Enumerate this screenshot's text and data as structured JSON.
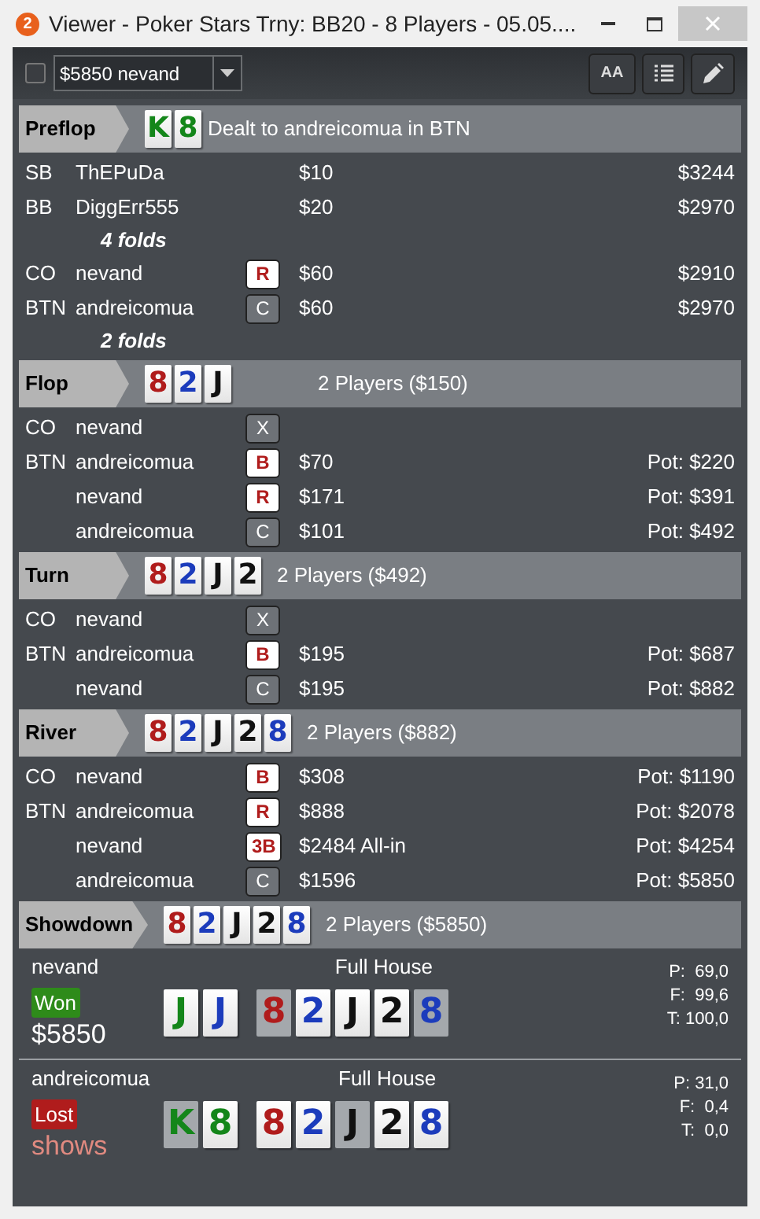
{
  "window": {
    "badge": "2",
    "title": "Viewer - Poker Stars Trny: BB20 - 8 Players - 05.05...."
  },
  "toolbar": {
    "checkbox": {
      "checked": false
    },
    "hand_select": {
      "value": "$5850 nevand"
    },
    "font_button": "AA"
  },
  "streets": [
    {
      "name": "Preflop",
      "cards": [
        {
          "rank": "K",
          "color": "#14861a"
        },
        {
          "rank": "8",
          "color": "#14861a"
        }
      ],
      "info": "Dealt to andreicomua in BTN",
      "rows": [
        {
          "kind": "action",
          "position": "SB",
          "player": "ThEPuDa",
          "amount": "$10",
          "right": "$3244"
        },
        {
          "kind": "action",
          "position": "BB",
          "player": "DiggErr555",
          "amount": "$20",
          "right": "$2970"
        },
        {
          "kind": "folds",
          "text": "4 folds"
        },
        {
          "kind": "action",
          "position": "CO",
          "player": "nevand",
          "action": {
            "label": "R",
            "aggressive": true
          },
          "amount": "$60",
          "right": "$2910"
        },
        {
          "kind": "action",
          "position": "BTN",
          "player": "andreicomua",
          "action": {
            "label": "C",
            "aggressive": false
          },
          "amount": "$60",
          "right": "$2970"
        },
        {
          "kind": "folds",
          "text": "2 folds"
        }
      ]
    },
    {
      "name": "Flop",
      "cards": [
        {
          "rank": "8",
          "color": "#b01c1c"
        },
        {
          "rank": "2",
          "color": "#1c3cbc"
        },
        {
          "rank": "J",
          "color": "#111111"
        }
      ],
      "info": "2 Players ($150)",
      "rows": [
        {
          "kind": "action",
          "position": "CO",
          "player": "nevand",
          "action": {
            "label": "X",
            "aggressive": false
          }
        },
        {
          "kind": "action",
          "position": "BTN",
          "player": "andreicomua",
          "action": {
            "label": "B",
            "aggressive": true
          },
          "amount": "$70",
          "right": "Pot: $220"
        },
        {
          "kind": "action",
          "player": "nevand",
          "action": {
            "label": "R",
            "aggressive": true
          },
          "amount": "$171",
          "right": "Pot: $391"
        },
        {
          "kind": "action",
          "player": "andreicomua",
          "action": {
            "label": "C",
            "aggressive": false
          },
          "amount": "$101",
          "right": "Pot: $492"
        }
      ]
    },
    {
      "name": "Turn",
      "cards": [
        {
          "rank": "8",
          "color": "#b01c1c"
        },
        {
          "rank": "2",
          "color": "#1c3cbc"
        },
        {
          "rank": "J",
          "color": "#111111"
        },
        {
          "rank": "2",
          "color": "#111111"
        }
      ],
      "info": "2 Players ($492)",
      "rows": [
        {
          "kind": "action",
          "position": "CO",
          "player": "nevand",
          "action": {
            "label": "X",
            "aggressive": false
          }
        },
        {
          "kind": "action",
          "position": "BTN",
          "player": "andreicomua",
          "action": {
            "label": "B",
            "aggressive": true
          },
          "amount": "$195",
          "right": "Pot: $687"
        },
        {
          "kind": "action",
          "player": "nevand",
          "action": {
            "label": "C",
            "aggressive": false
          },
          "amount": "$195",
          "right": "Pot: $882"
        }
      ]
    },
    {
      "name": "River",
      "cards": [
        {
          "rank": "8",
          "color": "#b01c1c"
        },
        {
          "rank": "2",
          "color": "#1c3cbc"
        },
        {
          "rank": "J",
          "color": "#111111"
        },
        {
          "rank": "2",
          "color": "#111111"
        },
        {
          "rank": "8",
          "color": "#1c3cbc"
        }
      ],
      "info": "2 Players ($882)",
      "rows": [
        {
          "kind": "action",
          "position": "CO",
          "player": "nevand",
          "action": {
            "label": "B",
            "aggressive": true
          },
          "amount": "$308",
          "right": "Pot: $1190"
        },
        {
          "kind": "action",
          "position": "BTN",
          "player": "andreicomua",
          "action": {
            "label": "R",
            "aggressive": true
          },
          "amount": "$888",
          "right": "Pot: $2078"
        },
        {
          "kind": "action",
          "player": "nevand",
          "action": {
            "label": "3B",
            "aggressive": true
          },
          "amount": "$2484 All-in",
          "right": "Pot: $4254"
        },
        {
          "kind": "action",
          "player": "andreicomua",
          "action": {
            "label": "C",
            "aggressive": false
          },
          "amount": "$1596",
          "right": "Pot: $5850"
        }
      ]
    }
  ],
  "showdown": {
    "name": "Showdown",
    "cards": [
      {
        "rank": "8",
        "color": "#b01c1c"
      },
      {
        "rank": "2",
        "color": "#1c3cbc"
      },
      {
        "rank": "J",
        "color": "#111111"
      },
      {
        "rank": "2",
        "color": "#111111"
      },
      {
        "rank": "8",
        "color": "#1c3cbc"
      }
    ],
    "info": "2 Players ($5850)",
    "players": [
      {
        "name": "nevand",
        "result": {
          "label": "Won",
          "won": true
        },
        "amount": "$5850",
        "hand_name": "Full House",
        "hole": [
          {
            "rank": "J",
            "color": "#14861a",
            "used": true
          },
          {
            "rank": "J",
            "color": "#1c3cbc",
            "used": true
          }
        ],
        "board": [
          {
            "rank": "8",
            "color": "#b01c1c",
            "used": false
          },
          {
            "rank": "2",
            "color": "#1c3cbc",
            "used": true
          },
          {
            "rank": "J",
            "color": "#111111",
            "used": true
          },
          {
            "rank": "2",
            "color": "#111111",
            "used": true
          },
          {
            "rank": "8",
            "color": "#1c3cbc",
            "used": false
          }
        ],
        "stats": [
          "P:  69,0",
          "F:  99,6",
          "T: 100,0"
        ]
      },
      {
        "name": "andreicomua",
        "result": {
          "label": "Lost",
          "won": false
        },
        "amount": "shows",
        "hand_name": "Full House",
        "hole": [
          {
            "rank": "K",
            "color": "#14861a",
            "used": false
          },
          {
            "rank": "8",
            "color": "#14861a",
            "used": true
          }
        ],
        "board": [
          {
            "rank": "8",
            "color": "#b01c1c",
            "used": true
          },
          {
            "rank": "2",
            "color": "#1c3cbc",
            "used": true
          },
          {
            "rank": "J",
            "color": "#111111",
            "used": false
          },
          {
            "rank": "2",
            "color": "#111111",
            "used": true
          },
          {
            "rank": "8",
            "color": "#1c3cbc",
            "used": true
          }
        ],
        "stats": [
          "P: 31,0",
          "F:  0,4",
          "T:  0,0"
        ]
      }
    ]
  }
}
